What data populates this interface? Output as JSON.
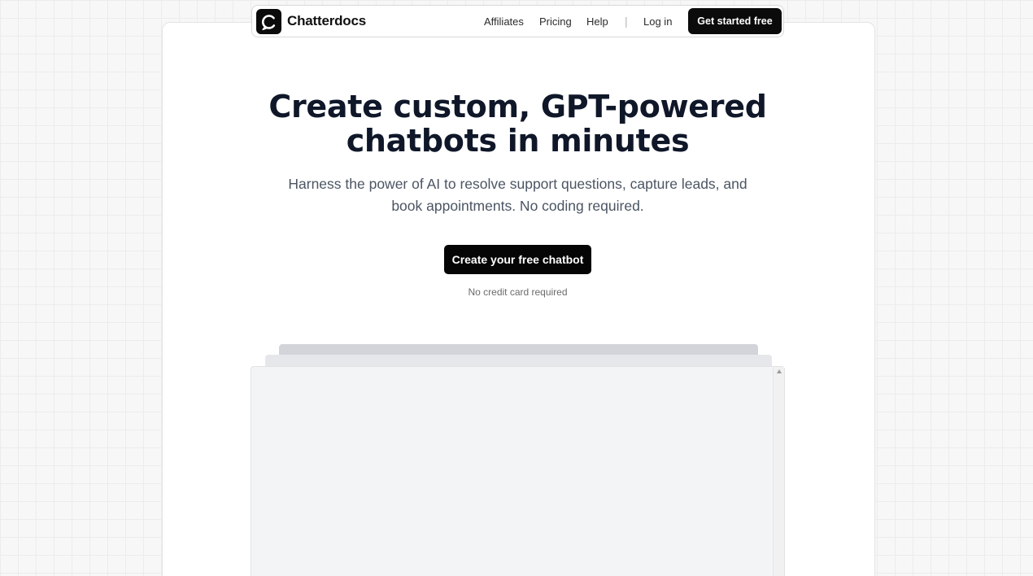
{
  "brand": {
    "name": "Chatterdocs",
    "logo_icon": "chat-bubble-c-logo-icon"
  },
  "nav": {
    "links": [
      {
        "label": "Affiliates"
      },
      {
        "label": "Pricing"
      },
      {
        "label": "Help"
      }
    ],
    "separator": "|",
    "login_label": "Log in",
    "cta_label": "Get started free"
  },
  "hero": {
    "title_line1": "Create custom, GPT-powered",
    "title_line2": "chatbots in minutes",
    "subtitle": "Harness the power of AI to resolve support questions, capture leads, and book appointments. No coding required.",
    "cta_label": "Create your free chatbot",
    "note": "No credit card required"
  },
  "colors": {
    "accent": "#0b0b0b",
    "title": "#0f1729",
    "subtitle": "#4b5563",
    "background": "#f7f7f7"
  }
}
